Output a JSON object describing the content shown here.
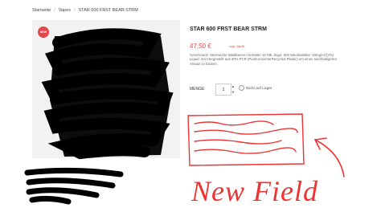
{
  "breadcrumb": {
    "home": "Startseite",
    "category": "Vapes",
    "current": "STAR 600 FRST BEAR STRM"
  },
  "product": {
    "badge": "NEW",
    "title": "STAR 600 FRST BEAR STRM",
    "price": "47,50 €",
    "tax_note": "zzgl. MwSt.",
    "description": "Geschmack: Stürmische Waldbeeren Getränk• 10 Stk. Züge: 600 Nikotinstärke: 20mg/ml (2%) Liquid: 2ml Hergestellt aus 40% PCR (PostConsumerRecycled Plastic) um einen nachhaltigeren Ansatz zu fördern.",
    "quantity_label": "MENGE",
    "quantity_value": "1",
    "stock_label": "Nicht auf Lager"
  },
  "annotation": {
    "text": "New Field",
    "color": "#e33333"
  }
}
